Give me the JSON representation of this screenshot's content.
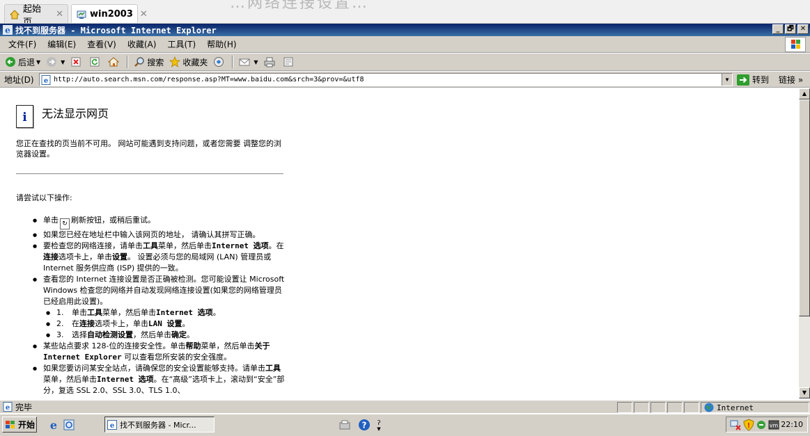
{
  "host_tabs": [
    {
      "label": "起始页",
      "icon": "home-icon",
      "active": false
    },
    {
      "label": "win2003",
      "icon": "vm-icon",
      "active": true
    }
  ],
  "host_ghost_text": "…网络连接设置…",
  "window": {
    "title": "找不到服务器 - Microsoft Internet Explorer",
    "minimize": "_",
    "restore": "🗗",
    "close": "✕"
  },
  "menu": [
    {
      "label": "文件",
      "key": "(F)"
    },
    {
      "label": "编辑",
      "key": "(E)"
    },
    {
      "label": "查看",
      "key": "(V)"
    },
    {
      "label": "收藏",
      "key": "(A)"
    },
    {
      "label": "工具",
      "key": "(T)"
    },
    {
      "label": "帮助",
      "key": "(H)"
    }
  ],
  "toolbar": {
    "back": "后退",
    "search": "搜索",
    "favorites": "收藏夹"
  },
  "address": {
    "label": "地址(D)",
    "url": "http://auto.search.msn.com/response.asp?MT=www.baidu.com&srch=3&prov=&utf8",
    "go": "转到",
    "links": "链接 »"
  },
  "page": {
    "title": "无法显示网页",
    "intro": "您正在查找的页当前不可用。 网站可能遇到支持问题，或者您需要 调整您的浏览器设置。",
    "try_heading": "请尝试以下操作:",
    "tip1_a": "单击",
    "tip1_b": "刷新按钮，或稍后重试。",
    "tip2": "如果您已经在地址栏中输入该网页的地址， 请确认其拼写正确。",
    "tip3_a": "要检查您的网络连接，请单击",
    "tip3_b": "工具",
    "tip3_c": "菜单，然后单击",
    "tip3_d": "Internet 选项",
    "tip3_e": "。在",
    "tip3_f": "连接",
    "tip3_g": "选项卡上，单击",
    "tip3_h": "设置",
    "tip3_i": "。 设置必须与您的局域网 (LAN) 管理员或 Internet 服务供应商 (ISP) 提供的一致。",
    "tip4": "查看您的 Internet 连接设置是否正确被检测。您可能设置让 Microsoft Windows 检查您的网络并自动发现网络连接设置(如果您的网络管理员已经启用此设置)。",
    "sub": [
      {
        "n": "1.",
        "a": "单击",
        "b": "工具",
        "c": "菜单，然后单击",
        "d": "Internet 选项",
        "e": "。"
      },
      {
        "n": "2.",
        "a": "在",
        "b": "连接",
        "c": "选项卡上，单击",
        "d": "LAN 设置",
        "e": "。"
      },
      {
        "n": "3.",
        "a": "选择",
        "b": "自动检测设置",
        "c": "，然后单击",
        "d": "确定",
        "e": "。"
      }
    ],
    "tip5_a": "某些站点要求 128-位的连接安全性。单击",
    "tip5_b": "帮助",
    "tip5_c": "菜单，然后单击",
    "tip5_d": "关于 Internet Explorer",
    "tip5_e": " 可以查看您所安装的安全强度。",
    "tip6_a": "如果您要访问某安全站点，请确保您的安全设置能够支持。请单击",
    "tip6_b": "工具",
    "tip6_c": "菜单，然后单击",
    "tip6_d": "Internet 选项",
    "tip6_e": "。在“高级”选项卡上，滚动到“安全”部分，复选 SSL 2.0、SSL 3.0、TLS 1.0、"
  },
  "status": {
    "text": "完毕",
    "zone": "Internet"
  },
  "taskbar": {
    "start": "开始",
    "task": "找不到服务器 - Micr...",
    "clock": "22:10"
  },
  "colors": {
    "titlebar": "#0a246a",
    "chrome": "#d4d0c8",
    "info_icon": "#0a2a9e"
  }
}
